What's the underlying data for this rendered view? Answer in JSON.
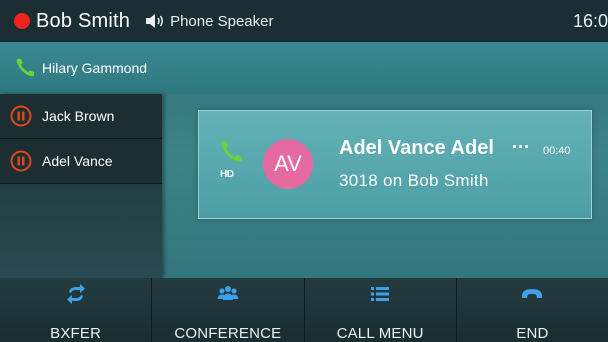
{
  "topbar": {
    "user_name": "Bob Smith",
    "speaker_label": "Phone Speaker",
    "clock": "16:0"
  },
  "active_call": {
    "name": "Hilary Gammond"
  },
  "held_calls": [
    {
      "name": "Jack Brown"
    },
    {
      "name": "Adel Vance"
    }
  ],
  "call_card": {
    "hd_label": "HD",
    "avatar_initials": "AV",
    "caller_name": "Adel Vance Adel",
    "more": "···",
    "duration": "00:40",
    "subtitle": "3018  on Bob Smith"
  },
  "softkeys": [
    {
      "label": "BXFER",
      "icon": "transfer-icon"
    },
    {
      "label": "CONFERENCE",
      "icon": "conference-icon"
    },
    {
      "label": "CALL MENU",
      "icon": "menu-icon"
    },
    {
      "label": "END",
      "icon": "hangup-icon"
    }
  ],
  "colors": {
    "status_red": "#f0231f",
    "phone_green": "#6ccf3c",
    "avatar_pink": "#e46aa1",
    "hold_orange": "#e1471f",
    "softkey_blue": "#3ea0e8"
  }
}
